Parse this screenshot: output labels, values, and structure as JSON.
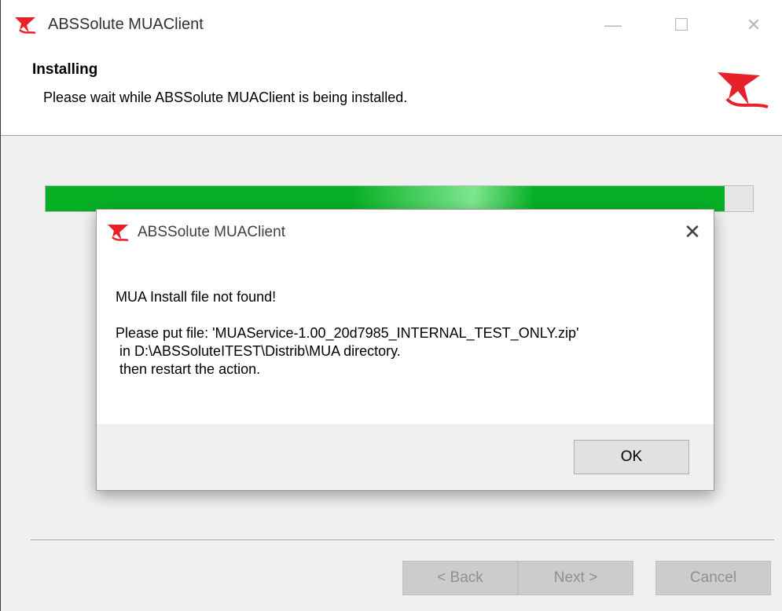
{
  "window": {
    "title": "ABSSolute MUAClient",
    "controls": {
      "minimize": "—",
      "maximize": "☐",
      "close": "✕"
    }
  },
  "header": {
    "title": "Installing",
    "subtitle": "Please wait while ABSSolute MUAClient is being installed."
  },
  "progress": {
    "value_percent": 96
  },
  "buttons": {
    "back": "< Back",
    "next": "Next >",
    "cancel": "Cancel"
  },
  "dialog": {
    "title": "ABSSolute MUAClient",
    "close": "✕",
    "message_lines": [
      "MUA Install file not found!",
      "",
      "Please put file: 'MUAService-1.00_20d7985_INTERNAL_TEST_ONLY.zip'",
      " in D:\\ABSSoluteITEST\\Distrib\\MUA directory.",
      " then restart the action."
    ],
    "ok": "OK"
  },
  "colors": {
    "progress_fill": "#06b025",
    "brand_logo": "#e8202a"
  }
}
